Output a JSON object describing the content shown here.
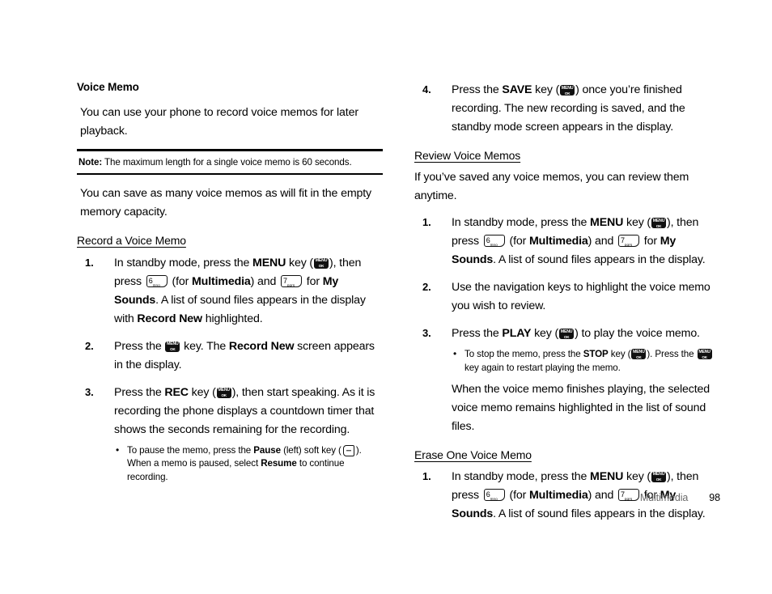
{
  "document": {
    "page_number": "98",
    "footer_label": "Multimedia"
  },
  "icons": {
    "menu_key": {
      "top": "MENU",
      "bottom": "OK",
      "name": "menu-ok-key-icon"
    },
    "key6": {
      "digit": "6",
      "letters": "mno"
    },
    "key7": {
      "digit": "7",
      "letters": "pqrs"
    },
    "soft_key_left": {
      "name": "left-soft-key-icon"
    }
  },
  "left_column": {
    "heading": "Voice Memo",
    "intro": "You can use your phone to record voice memos for later playback.",
    "note": {
      "label": "Note:",
      "text": " The maximum length for a single voice memo is 60 seconds."
    },
    "capacity_paragraph": "You can save as many voice memos as will fit in the empty memory capacity.",
    "subheading": "Record a Voice Memo",
    "steps": [
      {
        "num": "1.",
        "p1": "In standby mode, press the ",
        "b1": "MENU",
        "p2": " key (",
        "p3": "), then press",
        "p4": " (for ",
        "b2": "Multimedia",
        "p5": ") and ",
        "p6": " for ",
        "b3": "My Sounds",
        "p7": ". A list of sound files appears in the display with ",
        "b4": "Record New",
        "p8": " highlighted."
      },
      {
        "num": "2.",
        "p1": "Press the ",
        "p2": " key. The ",
        "b1": "Record New",
        "p3": " screen appears in the display."
      },
      {
        "num": "3.",
        "p1": "Press the ",
        "b1": "REC",
        "p2": " key (",
        "p3": "), then start speaking. As it is recording the phone displays a countdown timer that shows the seconds remaining for the recording.",
        "bullet": {
          "t1": "To pause the memo, press the ",
          "b1": "Pause",
          "t2": " (left) soft key (",
          "t3": "). When a memo is paused, select ",
          "b2": "Resume",
          "t4": " to continue recording."
        }
      }
    ]
  },
  "right_column": {
    "step4": {
      "num": "4.",
      "p1": "Press the ",
      "b1": "SAVE",
      "p2": " key (",
      "p3": ") once you’re finished recording. The new recording is saved, and the standby mode screen appears in the display."
    },
    "review": {
      "subheading": "Review Voice Memos",
      "intro": "If you’ve saved any voice memos, you can review them anytime.",
      "steps": [
        {
          "num": "1.",
          "p1": "In standby mode, press the ",
          "b1": "MENU",
          "p2": " key (",
          "p3": "), then press",
          "p4": " (for ",
          "b2": "Multimedia",
          "p5": ") and ",
          "p6": " for ",
          "b3": "My Sounds",
          "p7": ". A list of sound files appears in the display."
        },
        {
          "num": "2.",
          "p1": "Use the navigation keys to highlight the voice memo you wish to review."
        },
        {
          "num": "3.",
          "p1": "Press the ",
          "b1": "PLAY",
          "p2": " key (",
          "p3": ") to play the voice memo.",
          "bullet": {
            "t1": "To stop the memo, press the ",
            "b1": "STOP",
            "t2": " key (",
            "t3": "). Press the ",
            "t4": " key again to restart playing the memo."
          },
          "sub_para": "When the voice memo finishes playing, the selected voice memo remains highlighted in the list of sound files."
        }
      ]
    },
    "erase": {
      "subheading": "Erase One Voice Memo",
      "steps": [
        {
          "num": "1.",
          "p1": "In standby mode, press the ",
          "b1": "MENU",
          "p2": " key (",
          "p3": "), then press",
          "p4": " (for ",
          "b2": "Multimedia",
          "p5": ") and ",
          "p6": " for ",
          "b3": "My Sounds",
          "p7": ". A list of sound files appears in the display."
        }
      ]
    }
  }
}
